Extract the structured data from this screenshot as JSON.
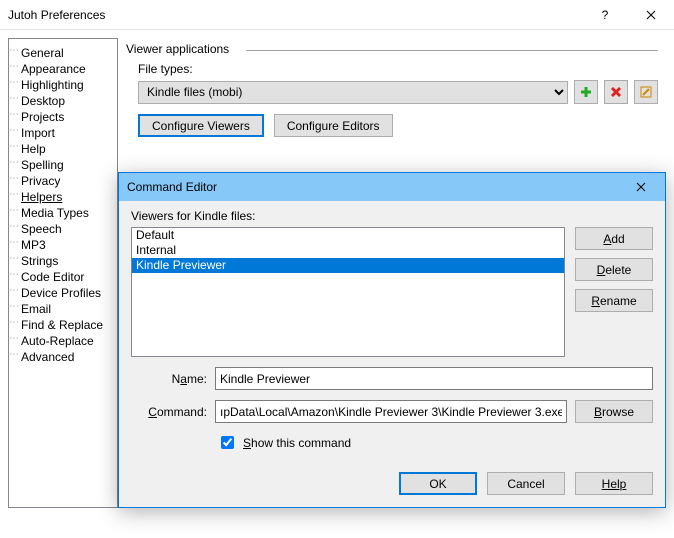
{
  "window": {
    "title": "Jutoh Preferences"
  },
  "tree": {
    "items": [
      "General",
      "Appearance",
      "Highlighting",
      "Desktop",
      "Projects",
      "Import",
      "Help",
      "Spelling",
      "Privacy",
      "Helpers",
      "Media Types",
      "Speech",
      "MP3",
      "Strings",
      "Code Editor",
      "Device Profiles",
      "Email",
      "Find & Replace",
      "Auto-Replace",
      "Advanced"
    ],
    "selected": "Helpers"
  },
  "viewer": {
    "section": "Viewer applications",
    "filetypes_label": "File types:",
    "filetype_value": "Kindle files (mobi)",
    "configure_viewers": "Configure Viewers",
    "configure_editors": "Configure Editors"
  },
  "dialog": {
    "title": "Command Editor",
    "list_label": "Viewers for Kindle files:",
    "items": [
      "Default",
      "Internal",
      "Kindle Previewer"
    ],
    "selected": "Kindle Previewer",
    "add": "Add",
    "delete": "Delete",
    "rename": "Rename",
    "name_label": "Name:",
    "name_value": "Kindle Previewer",
    "command_label": "Command:",
    "command_value": "ıpData\\Local\\Amazon\\Kindle Previewer 3\\Kindle Previewer 3.exe",
    "browse": "Browse",
    "show_cmd": "Show this command",
    "ok": "OK",
    "cancel": "Cancel",
    "help": "Help"
  },
  "footer": {
    "ok": "OK",
    "cancel": "Cancel",
    "help": "Help"
  }
}
